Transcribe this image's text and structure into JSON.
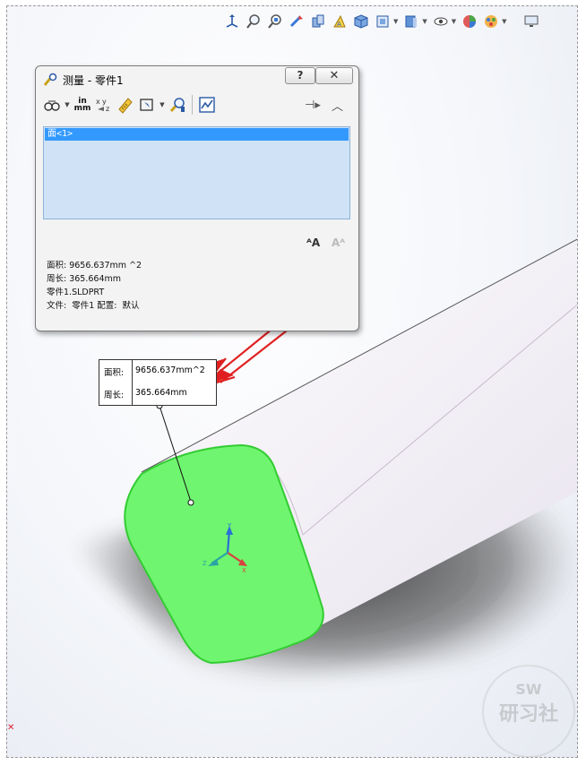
{
  "panel": {
    "title": "测量 - 零件1",
    "help_label": "?",
    "close_label": "✕",
    "unit_button": {
      "top": "in",
      "bottom": "mm"
    },
    "selection_items": [
      "面<1>"
    ],
    "results": [
      "面积: 9656.637mm ^2",
      "周长: 365.664mm",
      "零件1.SLDPRT",
      "文件:  零件1 配置:  默认"
    ]
  },
  "callout": {
    "area_label": "面积:",
    "area_value": "9656.637mm^2",
    "perimeter_label": "周长:",
    "perimeter_value": "365.664mm"
  },
  "triad": {
    "x": "X",
    "y": "Y",
    "z": "Z"
  },
  "watermark": {
    "line1": "SW",
    "line2": "研习社"
  },
  "colors": {
    "selected_face": "#6ff56f",
    "face_edge": "#33cc33",
    "arrow": "#e02020",
    "list_bg": "#cfe2f6",
    "list_selected": "#3399ff"
  }
}
